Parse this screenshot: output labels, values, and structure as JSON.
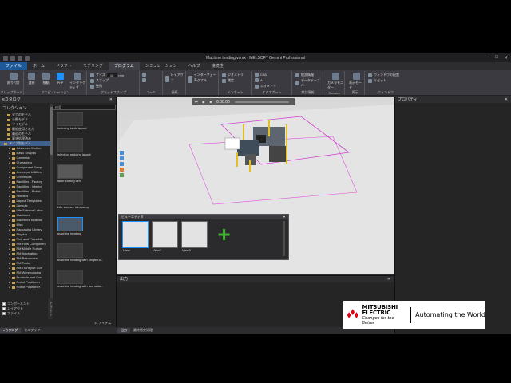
{
  "window": {
    "title": "Machine tending.vcmx - MELSOFT Gemini Professional",
    "controls": [
      "–",
      "□",
      "✕"
    ]
  },
  "tabs": [
    "ファイル",
    "ホーム",
    "ドラフト",
    "モデリング",
    "プログラム",
    "シミュレーション",
    "ヘルプ",
    "接続性"
  ],
  "ribbon": {
    "groups": {
      "clipboard": "クリップボード",
      "manipulation": "マニピュレーション",
      "grid_snap": "グリッドスナップ",
      "tools": "ツール",
      "connect": "接続",
      "import": "インポート",
      "export": "エクスポート",
      "tablet": "統計情報",
      "camera": "Camera",
      "display": "表示",
      "window": "ウィンドウ"
    },
    "buttons": {
      "paste": "貼り付け",
      "select": "選択",
      "move": "移動",
      "pnp": "PnP",
      "interactive": "インタラクティブ",
      "snap": "スナップ",
      "align": "整列",
      "dimensions": "サイズ",
      "grid_value": "10",
      "grid_units": "mm",
      "layout_config": "レイアウト",
      "interface": "インターフェース",
      "signal": "シグナル",
      "geometry": "ジオメトリ",
      "measure": "測定",
      "cad": "CAD",
      "ai": "AI",
      "cad_model": "ジオメトリ",
      "stat": "統計情報",
      "stat_table": "データテーブル",
      "camera_monitor": "カメラモニター",
      "renderer": "レンダー",
      "display_mode": "表示モード",
      "window_layout": "ウィンドウの配置",
      "window_reset": "リセット"
    }
  },
  "left_panel": {
    "title": "eカタログ",
    "pin": "✕",
    "collection_header": "コレクション",
    "search_placeholder": "検索",
    "tree": [
      {
        "label": "全てのモデル",
        "indent": 1
      },
      {
        "label": "公開モデル",
        "indent": 1
      },
      {
        "label": "マイモデル",
        "indent": 1
      },
      {
        "label": "最近使用された",
        "indent": 1
      },
      {
        "label": "最近のモデル",
        "indent": 1
      },
      {
        "label": "要求処理済み",
        "indent": 1
      },
      {
        "label": "タイプ別モデル",
        "indent": 0,
        "sel": true
      },
      {
        "label": "Advanced Motion",
        "indent": 2
      },
      {
        "label": "Basic Shapes",
        "indent": 2
      },
      {
        "label": "Cameras",
        "indent": 2
      },
      {
        "label": "Characters",
        "indent": 2
      },
      {
        "label": "Component Samp",
        "indent": 2
      },
      {
        "label": "Conveyor Utilities",
        "indent": 2
      },
      {
        "label": "Conveyors",
        "indent": 2
      },
      {
        "label": "Facilities - Factory",
        "indent": 2
      },
      {
        "label": "Facilities - Interior",
        "indent": 2
      },
      {
        "label": "Facilities - Robot",
        "indent": 2
      },
      {
        "label": "Feeders",
        "indent": 2
      },
      {
        "label": "Layout Templates",
        "indent": 2
      },
      {
        "label": "Layouts",
        "indent": 2
      },
      {
        "label": "Life Science Labor",
        "indent": 2
      },
      {
        "label": "Machines",
        "indent": 2
      },
      {
        "label": "Machines to allow",
        "indent": 2
      },
      {
        "label": "Misc",
        "indent": 2
      },
      {
        "label": "Packaging Library",
        "indent": 2
      },
      {
        "label": "Physics",
        "indent": 2
      },
      {
        "label": "Pick and Place Lib",
        "indent": 2
      },
      {
        "label": "PM Flow Componen",
        "indent": 2
      },
      {
        "label": "PM Mobile Robots",
        "indent": 2
      },
      {
        "label": "PM Navigation",
        "indent": 2
      },
      {
        "label": "PM Resources",
        "indent": 2
      },
      {
        "label": "PM Tools",
        "indent": 2
      },
      {
        "label": "PM Transport Con",
        "indent": 2
      },
      {
        "label": "PM Warehousing",
        "indent": 2
      },
      {
        "label": "Products and Con",
        "indent": 2
      },
      {
        "label": "Robot Positioner",
        "indent": 2
      },
      {
        "label": "Robot Positioner",
        "indent": 2
      }
    ],
    "gallery": [
      {
        "caption": "indexing table layout",
        "dark": false
      },
      {
        "caption": "injection molding layout",
        "dark": false
      },
      {
        "caption": "laser cutting cell",
        "dark": true
      },
      {
        "caption": "Life science laboratory",
        "dark": false
      },
      {
        "caption": "machine tending",
        "dark": false,
        "sel": true
      },
      {
        "caption": "machine tending with single ro...",
        "dark": false
      },
      {
        "caption": "machine tending with tool auto...",
        "dark": false
      }
    ],
    "side_tab": "テンプレート",
    "checkboxes": [
      "コンポーネント",
      "レイアウト",
      "ファイル"
    ],
    "item_count": "14 アイテム",
    "bottom_tabs": [
      "eカタログ",
      "セルグラフ"
    ]
  },
  "viewport": {
    "time": "0:00:00",
    "view_editor": {
      "title": "ビューエディタ",
      "close": "▾",
      "views": [
        "View",
        "View2",
        "View3"
      ],
      "plus": "+"
    }
  },
  "right_panel": {
    "title": "プロパティ",
    "pin": "✕"
  },
  "output_panel": {
    "title": "出力",
    "pin": "✕",
    "bottom_tabs": [
      "出力",
      "最終衝突処理"
    ]
  },
  "logo": {
    "brand_line1": "MITSUBISHI",
    "brand_line2": "ELECTRIC",
    "slogan": "Changes for the Better",
    "tagline": "Automating the World",
    "colors": {
      "mark": "#e60012",
      "text": "#000000"
    }
  }
}
